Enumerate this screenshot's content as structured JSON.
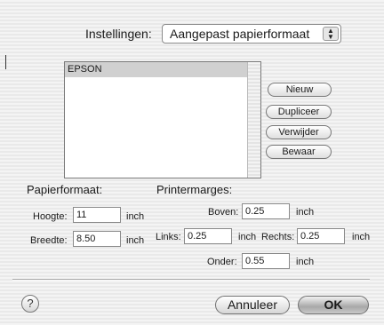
{
  "settings": {
    "label": "Instellingen:",
    "selected": "Aangepast papierformaat"
  },
  "list": {
    "items": [
      "EPSON"
    ]
  },
  "side_buttons": {
    "new": "Nieuw",
    "duplicate": "Dupliceer",
    "delete": "Verwijder",
    "save": "Bewaar"
  },
  "paper": {
    "heading": "Papierformaat:",
    "height_label": "Hoogte:",
    "height_value": "11",
    "height_unit": "inch",
    "width_label": "Breedte:",
    "width_value": "8.50",
    "width_unit": "inch"
  },
  "margins": {
    "heading": "Printermarges:",
    "top_label": "Boven:",
    "top_value": "0.25",
    "top_unit": "inch",
    "left_label": "Links:",
    "left_value": "0.25",
    "left_unit": "inch",
    "right_label": "Rechts:",
    "right_value": "0.25",
    "right_unit": "inch",
    "bottom_label": "Onder:",
    "bottom_value": "0.55",
    "bottom_unit": "inch"
  },
  "footer": {
    "help": "?",
    "cancel": "Annuleer",
    "ok": "OK"
  },
  "icons": {
    "popup": "up-down-arrows-icon",
    "help": "question-mark-icon"
  }
}
